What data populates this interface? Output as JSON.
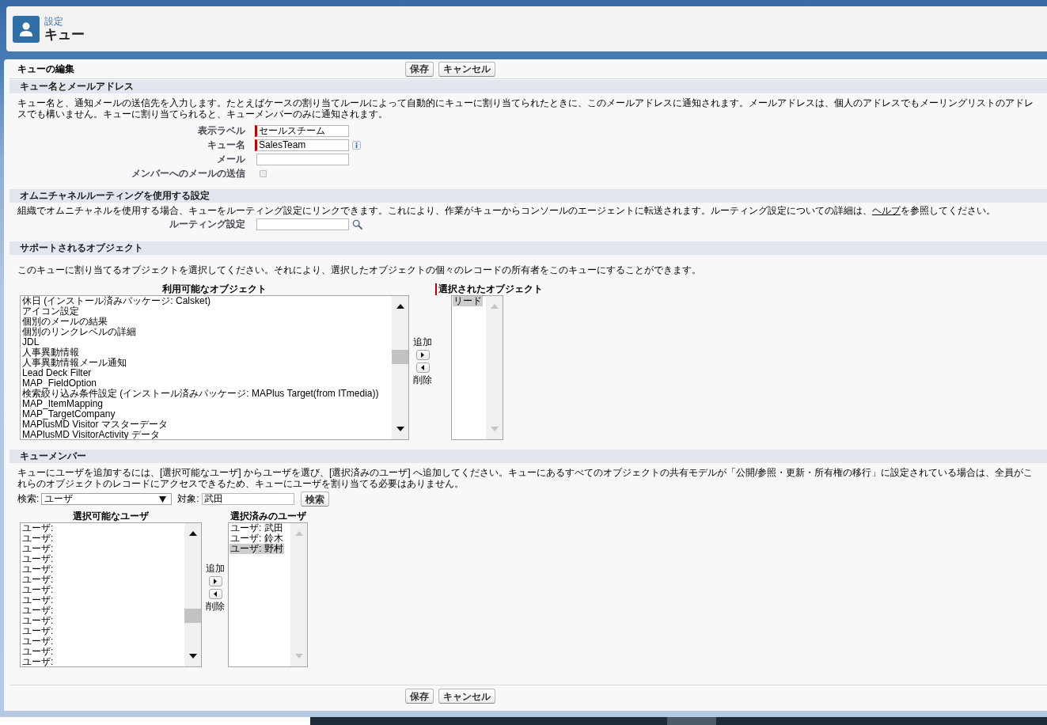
{
  "header": {
    "breadcrumb": "設定",
    "title": "キュー"
  },
  "edit_bar": {
    "title": "キューの編集",
    "buttons": [
      "保存",
      "キャンセル"
    ]
  },
  "queue_name_section": {
    "title": "キュー名とメールアドレス",
    "description": "キュー名と、通知メールの送信先を入力します。たとえばケースの割り当てルールによって自動的にキューに割り当てられたときに、このメールアドレスに通知されます。メールアドレスは、個人のアドレスでもメーリングリストのアドレスでも構いません。キューに割り当てられると、キューメンバーのみに通知されます。",
    "fields": [
      {
        "kind": "text",
        "label": "表示ラベル",
        "value": "セールスチーム",
        "required": true
      },
      {
        "kind": "text",
        "label": "キュー名",
        "value": "SalesTeam",
        "required": true,
        "info_icon": true
      },
      {
        "kind": "text",
        "label": "メール",
        "required": false
      },
      {
        "kind": "checkbox",
        "label": "メンバーへのメールの送信",
        "checked": false
      }
    ]
  },
  "routing_section": {
    "title": "オムニチャネルルーティングを使用する設定",
    "description": [
      {
        "kind": "text",
        "text": "組織でオムニチャネルを使用する場合、キューをルーティング設定にリンクできます。これにより、作業がキューからコンソールのエージェントに転送されます。ルーティング設定についての詳細は、"
      },
      {
        "kind": "link",
        "text": "ヘルプ"
      },
      {
        "kind": "text",
        "text": "を参照してください。"
      }
    ],
    "fields": [
      {
        "kind": "lookup",
        "label": "ルーティング設定",
        "required": false
      }
    ]
  },
  "objects_section": {
    "title": "サポートされるオブジェクト",
    "description": "このキューに割り当てるオブジェクトを選択してください。それにより、選択したオブジェクトの個々のレコードの所有者をこのキューにすることができます。",
    "available_list": {
      "heading": "利用可能なオブジェクト",
      "items": [
        {
          "label": "休日 (インストール済みパッケージ: Calsket)",
          "selected": false
        },
        {
          "label": "アイコン設定",
          "selected": false
        },
        {
          "label": "個別のメールの結果",
          "selected": false
        },
        {
          "label": "個別のリンクレベルの詳細",
          "selected": false
        },
        {
          "label": "JDL",
          "selected": false
        },
        {
          "label": "人事異動情報",
          "selected": false
        },
        {
          "label": "人事異動情報メール通知",
          "selected": false
        },
        {
          "label": "Lead Deck Filter",
          "selected": false
        },
        {
          "label": "MAP_FieldOption",
          "selected": false
        },
        {
          "label": "検索絞り込み条件設定 (インストール済みパッケージ: MAPlus Target(from ITmedia))",
          "selected": false
        },
        {
          "label": "MAP_ItemMapping",
          "selected": false
        },
        {
          "label": "MAP_TargetCompany",
          "selected": false
        },
        {
          "label": "MAPlusMD Visitor マスターデータ",
          "selected": false
        },
        {
          "label": "MAPlusMD VisitorActivity データ",
          "selected": false
        }
      ]
    },
    "add_label": "追加",
    "remove_label": "削除",
    "chosen_list": {
      "heading": "選択されたオブジェクト",
      "required": true,
      "items": [
        {
          "label": "リード",
          "selected": true
        }
      ]
    }
  },
  "members_section": {
    "title": "キューメンバー",
    "description": "キューにユーザを追加するには、[選択可能なユーザ] からユーザを選び、[選択済みのユーザ] へ追加してください。キューにあるすべてのオブジェクトの共有モデルが「公開/参照・更新・所有権の移行」に設定されている場合は、全員がこれらのオブジェクトのレコードにアクセスできるため、キューにユーザを割り当てる必要はありません。",
    "search": {
      "label": "検索:",
      "option": "ユーザ",
      "target_label": "対象:",
      "target_value": "武田",
      "button": "検索"
    },
    "available_list": {
      "heading": "選択可能なユーザ",
      "items": [
        {
          "label": "ユーザ:",
          "selected": false
        },
        {
          "label": "ユーザ:",
          "selected": false
        },
        {
          "label": "ユーザ:",
          "selected": false
        },
        {
          "label": "ユーザ:",
          "selected": false
        },
        {
          "label": "ユーザ:",
          "selected": false
        },
        {
          "label": "ユーザ:",
          "selected": false
        },
        {
          "label": "ユーザ:",
          "selected": false
        },
        {
          "label": "ユーザ:",
          "selected": false
        },
        {
          "label": "ユーザ:",
          "selected": false
        },
        {
          "label": "ユーザ:",
          "selected": false
        },
        {
          "label": "ユーザ:",
          "selected": false
        },
        {
          "label": "ユーザ:",
          "selected": false
        },
        {
          "label": "ユーザ:",
          "selected": false
        },
        {
          "label": "ユーザ:",
          "selected": false
        }
      ]
    },
    "add_label": "追加",
    "remove_label": "削除",
    "chosen_list": {
      "heading": "選択済みのユーザ",
      "items": [
        {
          "label": "ユーザ: 武田",
          "selected": false
        },
        {
          "label": "ユーザ: 鈴木",
          "selected": false
        },
        {
          "label": "ユーザ: 野村",
          "selected": true
        }
      ]
    }
  },
  "footer_buttons": [
    "保存",
    "キャンセル"
  ]
}
